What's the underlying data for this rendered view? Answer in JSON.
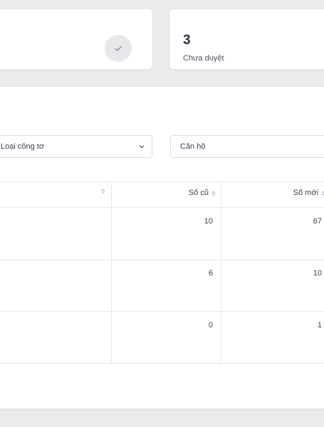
{
  "stats": {
    "pending": {
      "count": "3",
      "label": "Chưa duyệt"
    }
  },
  "filters": {
    "meter_type_placeholder": "Loại công tơ",
    "apartment_placeholder": "Căn hộ"
  },
  "table": {
    "columns": [
      "Số cũ",
      "Số mới"
    ],
    "rows": [
      {
        "old": "10",
        "new": "67"
      },
      {
        "old": "6",
        "new": "10"
      },
      {
        "old": "0",
        "new": "1"
      }
    ]
  },
  "icons": {
    "approved": "check-icon",
    "dropdown": "chevron-down-icon",
    "sort": "sort-icon"
  },
  "colors": {
    "background": "#ebebeb",
    "card": "#ffffff",
    "border": "#e6e7eb"
  }
}
